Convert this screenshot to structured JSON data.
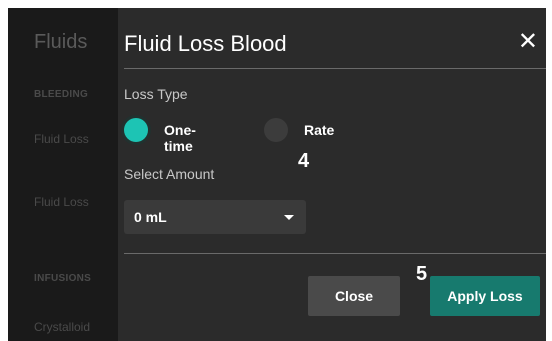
{
  "background": {
    "title": "Fluids",
    "sections": [
      {
        "heading": "BLEEDING",
        "items": [
          "Fluid Loss",
          "Fluid Loss"
        ]
      },
      {
        "heading": "INFUSIONS",
        "items": [
          "Crystalloid"
        ]
      }
    ]
  },
  "modal": {
    "title": "Fluid Loss Blood",
    "close_icon": "close-icon",
    "loss_type_label": "Loss Type",
    "options": [
      {
        "label": "One-time",
        "selected": true
      },
      {
        "label": "Rate",
        "selected": false
      }
    ],
    "select_amount_label": "Select Amount",
    "amount_value": "0 mL",
    "buttons": {
      "close": "Close",
      "apply": "Apply Loss"
    }
  },
  "markers": {
    "step4": "4",
    "step5": "5"
  },
  "colors": {
    "accent": "#1dc4b4",
    "apply_button": "#177a6e",
    "modal_bg": "#2b2b2b"
  }
}
